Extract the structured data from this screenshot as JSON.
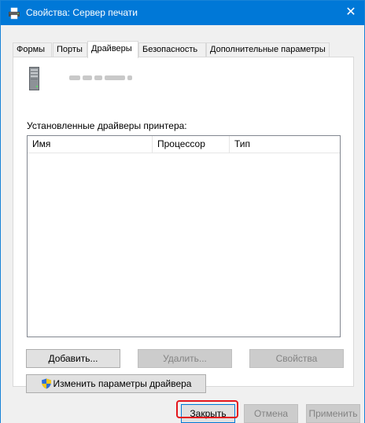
{
  "window": {
    "title": "Свойства: Сервер печати",
    "close_glyph": "✕"
  },
  "tabs": [
    {
      "label": "Формы",
      "active": false
    },
    {
      "label": "Порты",
      "active": false
    },
    {
      "label": "Драйверы",
      "active": true
    },
    {
      "label": "Безопасность",
      "active": false
    },
    {
      "label": "Дополнительные параметры",
      "active": false
    }
  ],
  "drivers_tab": {
    "installed_label": "Установленные драйверы принтера:",
    "columns": [
      "Имя",
      "Процессор",
      "Тип"
    ],
    "rows": []
  },
  "buttons": {
    "add": "Добавить...",
    "remove": "Удалить...",
    "properties": "Свойства",
    "change_driver_settings": "Изменить параметры драйвера",
    "close": "Закрыть",
    "cancel": "Отмена",
    "apply": "Применить"
  },
  "icons": {
    "title": "printer-icon",
    "server": "server-icon",
    "uac": "uac-shield-icon"
  },
  "colors": {
    "titlebar": "#0078d7",
    "highlight": "#e3161c"
  }
}
